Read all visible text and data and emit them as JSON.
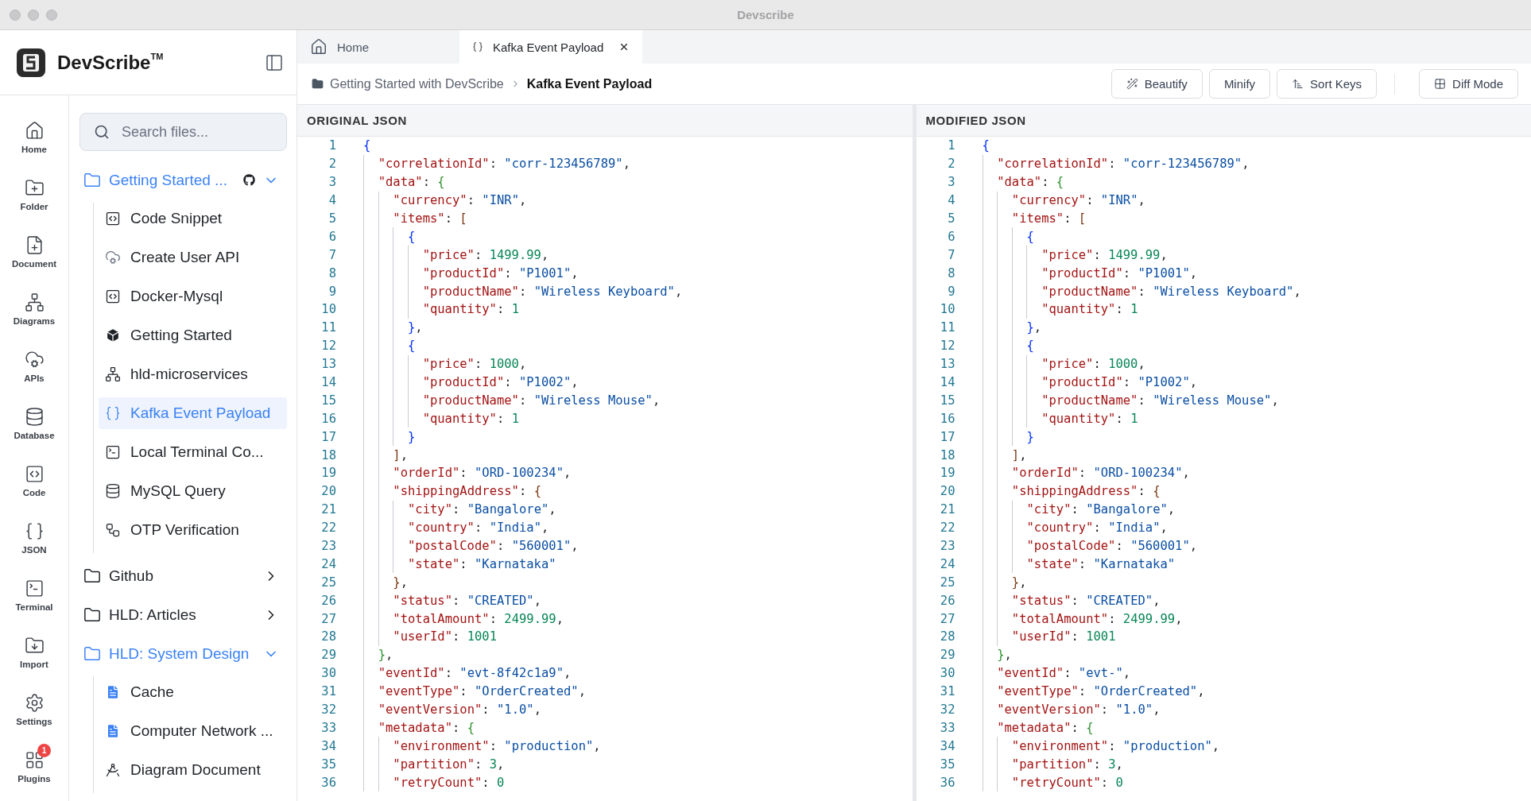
{
  "window": {
    "title": "Devscribe"
  },
  "sidebar": {
    "logo": "DevScribe$^{TM}$",
    "nav": [
      {
        "label": "Home",
        "kind": "home"
      },
      {
        "label": "Folder",
        "kind": "folder"
      },
      {
        "label": "Document",
        "kind": "document"
      },
      {
        "label": "Diagrams",
        "kind": "diagram"
      },
      {
        "label": "APIs",
        "kind": "api"
      },
      {
        "label": "Database",
        "kind": "database"
      },
      {
        "label": "Code",
        "kind": "code"
      },
      {
        "label": "JSON",
        "kind": "json"
      },
      {
        "label": "Terminal",
        "kind": "terminal"
      },
      {
        "label": "Import",
        "kind": "import"
      },
      {
        "label": "Settings",
        "kind": "settings"
      },
      {
        "label": "Plugins",
        "kind": "plugins",
        "badge": "1"
      }
    ],
    "search": {
      "placeholder": "Search files..."
    },
    "tree": [
      {
        "label": "Getting Started ...",
        "expanded": true,
        "repo_linked": true,
        "children": [
          {
            "label": "Code Snippet",
            "kind": "code",
            "selected": false
          },
          {
            "label": "Create User API",
            "kind": "api",
            "selected": false
          },
          {
            "label": "Docker-Mysql",
            "kind": "code",
            "selected": false
          },
          {
            "label": "Getting Started",
            "kind": "cube",
            "selected": false
          },
          {
            "label": "hld-microservices",
            "kind": "network",
            "selected": false
          },
          {
            "label": "Kafka Event Payload",
            "kind": "json",
            "selected": true
          },
          {
            "label": "Local Terminal Co...",
            "kind": "terminal",
            "selected": false
          },
          {
            "label": "MySQL Query",
            "kind": "database",
            "selected": false
          },
          {
            "label": "OTP Verification",
            "kind": "flow",
            "selected": false
          }
        ]
      },
      {
        "label": "Github",
        "expanded": false,
        "repo_linked": false
      },
      {
        "label": "HLD: Articles",
        "expanded": false,
        "repo_linked": false
      },
      {
        "label": "HLD: System Design",
        "expanded": true,
        "repo_linked": false,
        "children": [
          {
            "label": "Cache",
            "kind": "doc",
            "selected": false
          },
          {
            "label": "Computer Network ...",
            "kind": "doc",
            "selected": false
          },
          {
            "label": "Diagram Document",
            "kind": "diagram",
            "selected": false
          }
        ]
      }
    ]
  },
  "tabs": [
    {
      "label": "Home",
      "kind": "home",
      "selected": false,
      "closable": false
    },
    {
      "label": "Kafka Event Payload",
      "kind": "json",
      "selected": true,
      "closable": true
    }
  ],
  "breadcrumb": [
    "Getting Started with DevScribe",
    "Kafka Event Payload"
  ],
  "toolbar": [
    {
      "label": "Beautify",
      "kind": "beautify"
    },
    {
      "label": "Minify",
      "kind": "minify"
    },
    {
      "label": "Sort Keys",
      "kind": "sort"
    },
    {
      "label": "Diff Mode",
      "kind": "diff"
    }
  ],
  "panels": [
    {
      "title": "ORIGINAL JSON",
      "lines": [
        {
          "no": "1",
          "tokens": [
            {
              "kind": "open",
              "text": "{",
              "color": "#0431fa"
            }
          ]
        },
        {
          "no": "2",
          "tokens": [
            {
              "kind": "key",
              "text": "\"correlationId\""
            },
            {
              "kind": "punct",
              "text": ": "
            },
            {
              "kind": "string",
              "text": "\"corr-123456789\""
            },
            {
              "kind": "punct",
              "text": ","
            }
          ]
        },
        {
          "no": "3",
          "tokens": [
            {
              "kind": "key",
              "text": "\"data\""
            },
            {
              "kind": "punct",
              "text": ": "
            },
            {
              "kind": "open",
              "text": "{",
              "color": "#319331"
            }
          ]
        },
        {
          "no": "4",
          "tokens": [
            {
              "kind": "key",
              "text": "\"currency\""
            },
            {
              "kind": "punct",
              "text": ": "
            },
            {
              "kind": "string",
              "text": "\"INR\""
            },
            {
              "kind": "punct",
              "text": ","
            }
          ]
        },
        {
          "no": "5",
          "tokens": [
            {
              "kind": "key",
              "text": "\"items\""
            },
            {
              "kind": "punct",
              "text": ": "
            },
            {
              "kind": "open",
              "text": "[",
              "color": "#7b3814"
            }
          ]
        },
        {
          "no": "6",
          "tokens": [
            {
              "kind": "open",
              "text": "{",
              "color": "#0431fa"
            }
          ]
        },
        {
          "no": "7",
          "tokens": [
            {
              "kind": "key",
              "text": "\"price\""
            },
            {
              "kind": "punct",
              "text": ": "
            },
            {
              "kind": "number",
              "text": "1499.99"
            },
            {
              "kind": "punct",
              "text": ","
            }
          ]
        },
        {
          "no": "8",
          "tokens": [
            {
              "kind": "key",
              "text": "\"productId\""
            },
            {
              "kind": "punct",
              "text": ": "
            },
            {
              "kind": "string",
              "text": "\"P1001\""
            },
            {
              "kind": "punct",
              "text": ","
            }
          ]
        },
        {
          "no": "9",
          "tokens": [
            {
              "kind": "key",
              "text": "\"productName\""
            },
            {
              "kind": "punct",
              "text": ": "
            },
            {
              "kind": "string",
              "text": "\"Wireless Keyboard\""
            },
            {
              "kind": "punct",
              "text": ","
            }
          ]
        },
        {
          "no": "10",
          "tokens": [
            {
              "kind": "key",
              "text": "\"quantity\""
            },
            {
              "kind": "punct",
              "text": ": "
            },
            {
              "kind": "number",
              "text": "1"
            }
          ]
        },
        {
          "no": "11",
          "tokens": [
            {
              "kind": "close",
              "text": "}",
              "color": "#0431fa"
            },
            {
              "kind": "punct",
              "text": ","
            }
          ]
        },
        {
          "no": "12",
          "tokens": [
            {
              "kind": "open",
              "text": "{",
              "color": "#0431fa"
            }
          ]
        },
        {
          "no": "13",
          "tokens": [
            {
              "kind": "key",
              "text": "\"price\""
            },
            {
              "kind": "punct",
              "text": ": "
            },
            {
              "kind": "number",
              "text": "1000"
            },
            {
              "kind": "punct",
              "text": ","
            }
          ]
        },
        {
          "no": "14",
          "tokens": [
            {
              "kind": "key",
              "text": "\"productId\""
            },
            {
              "kind": "punct",
              "text": ": "
            },
            {
              "kind": "string",
              "text": "\"P1002\""
            },
            {
              "kind": "punct",
              "text": ","
            }
          ]
        },
        {
          "no": "15",
          "tokens": [
            {
              "kind": "key",
              "text": "\"productName\""
            },
            {
              "kind": "punct",
              "text": ": "
            },
            {
              "kind": "string",
              "text": "\"Wireless Mouse\""
            },
            {
              "kind": "punct",
              "text": ","
            }
          ]
        },
        {
          "no": "16",
          "tokens": [
            {
              "kind": "key",
              "text": "\"quantity\""
            },
            {
              "kind": "punct",
              "text": ": "
            },
            {
              "kind": "number",
              "text": "1"
            }
          ]
        },
        {
          "no": "17",
          "tokens": [
            {
              "kind": "close",
              "text": "}",
              "color": "#0431fa"
            }
          ]
        },
        {
          "no": "18",
          "tokens": [
            {
              "kind": "close",
              "text": "]",
              "color": "#7b3814"
            },
            {
              "kind": "punct",
              "text": ","
            }
          ]
        },
        {
          "no": "19",
          "tokens": [
            {
              "kind": "key",
              "text": "\"orderId\""
            },
            {
              "kind": "punct",
              "text": ": "
            },
            {
              "kind": "string",
              "text": "\"ORD-100234\""
            },
            {
              "kind": "punct",
              "text": ","
            }
          ]
        },
        {
          "no": "20",
          "tokens": [
            {
              "kind": "key",
              "text": "\"shippingAddress\""
            },
            {
              "kind": "punct",
              "text": ": "
            },
            {
              "kind": "open",
              "text": "{",
              "color": "#7b3814"
            }
          ]
        },
        {
          "no": "21",
          "tokens": [
            {
              "kind": "key",
              "text": "\"city\""
            },
            {
              "kind": "punct",
              "text": ": "
            },
            {
              "kind": "string",
              "text": "\"Bangalore\""
            },
            {
              "kind": "punct",
              "text": ","
            }
          ]
        },
        {
          "no": "22",
          "tokens": [
            {
              "kind": "key",
              "text": "\"country\""
            },
            {
              "kind": "punct",
              "text": ": "
            },
            {
              "kind": "string",
              "text": "\"India\""
            },
            {
              "kind": "punct",
              "text": ","
            }
          ]
        },
        {
          "no": "23",
          "tokens": [
            {
              "kind": "key",
              "text": "\"postalCode\""
            },
            {
              "kind": "punct",
              "text": ": "
            },
            {
              "kind": "string",
              "text": "\"560001\""
            },
            {
              "kind": "punct",
              "text": ","
            }
          ]
        },
        {
          "no": "24",
          "tokens": [
            {
              "kind": "key",
              "text": "\"state\""
            },
            {
              "kind": "punct",
              "text": ": "
            },
            {
              "kind": "string",
              "text": "\"Karnataka\""
            }
          ]
        },
        {
          "no": "25",
          "tokens": [
            {
              "kind": "close",
              "text": "}",
              "color": "#7b3814"
            },
            {
              "kind": "punct",
              "text": ","
            }
          ]
        },
        {
          "no": "26",
          "tokens": [
            {
              "kind": "key",
              "text": "\"status\""
            },
            {
              "kind": "punct",
              "text": ": "
            },
            {
              "kind": "string",
              "text": "\"CREATED\""
            },
            {
              "kind": "punct",
              "text": ","
            }
          ]
        },
        {
          "no": "27",
          "tokens": [
            {
              "kind": "key",
              "text": "\"totalAmount\""
            },
            {
              "kind": "punct",
              "text": ": "
            },
            {
              "kind": "number",
              "text": "2499.99"
            },
            {
              "kind": "punct",
              "text": ","
            }
          ]
        },
        {
          "no": "28",
          "tokens": [
            {
              "kind": "key",
              "text": "\"userId\""
            },
            {
              "kind": "punct",
              "text": ": "
            },
            {
              "kind": "number",
              "text": "1001"
            }
          ]
        },
        {
          "no": "29",
          "tokens": [
            {
              "kind": "close",
              "text": "}",
              "color": "#319331"
            },
            {
              "kind": "punct",
              "text": ","
            }
          ]
        },
        {
          "no": "30",
          "tokens": [
            {
              "kind": "key",
              "text": "\"eventId\""
            },
            {
              "kind": "punct",
              "text": ": "
            },
            {
              "kind": "string",
              "text": "\"evt-8f42c1a9\""
            },
            {
              "kind": "punct",
              "text": ","
            }
          ]
        },
        {
          "no": "31",
          "tokens": [
            {
              "kind": "key",
              "text": "\"eventType\""
            },
            {
              "kind": "punct",
              "text": ": "
            },
            {
              "kind": "string",
              "text": "\"OrderCreated\""
            },
            {
              "kind": "punct",
              "text": ","
            }
          ]
        },
        {
          "no": "32",
          "tokens": [
            {
              "kind": "key",
              "text": "\"eventVersion\""
            },
            {
              "kind": "punct",
              "text": ": "
            },
            {
              "kind": "string",
              "text": "\"1.0\""
            },
            {
              "kind": "punct",
              "text": ","
            }
          ]
        },
        {
          "no": "33",
          "tokens": [
            {
              "kind": "key",
              "text": "\"metadata\""
            },
            {
              "kind": "punct",
              "text": ": "
            },
            {
              "kind": "open",
              "text": "{",
              "color": "#319331"
            }
          ]
        },
        {
          "no": "34",
          "tokens": [
            {
              "kind": "key",
              "text": "\"environment\""
            },
            {
              "kind": "punct",
              "text": ": "
            },
            {
              "kind": "string",
              "text": "\"production\""
            },
            {
              "kind": "punct",
              "text": ","
            }
          ]
        },
        {
          "no": "35",
          "tokens": [
            {
              "kind": "key",
              "text": "\"partition\""
            },
            {
              "kind": "punct",
              "text": ": "
            },
            {
              "kind": "number",
              "text": "3"
            },
            {
              "kind": "punct",
              "text": ","
            }
          ]
        },
        {
          "no": "36",
          "tokens": [
            {
              "kind": "key",
              "text": "\"retryCount\""
            },
            {
              "kind": "punct",
              "text": ": "
            },
            {
              "kind": "number",
              "text": "0"
            }
          ]
        }
      ]
    },
    {
      "title": "MODIFIED JSON",
      "lines": [
        {
          "no": "1",
          "tokens": [
            {
              "kind": "open",
              "text": "{",
              "color": "#0431fa"
            }
          ]
        },
        {
          "no": "2",
          "tokens": [
            {
              "kind": "key",
              "text": "\"correlationId\""
            },
            {
              "kind": "punct",
              "text": ": "
            },
            {
              "kind": "string",
              "text": "\"corr-123456789\""
            },
            {
              "kind": "punct",
              "text": ","
            }
          ]
        },
        {
          "no": "3",
          "tokens": [
            {
              "kind": "key",
              "text": "\"data\""
            },
            {
              "kind": "punct",
              "text": ": "
            },
            {
              "kind": "open",
              "text": "{",
              "color": "#319331"
            }
          ]
        },
        {
          "no": "4",
          "tokens": [
            {
              "kind": "key",
              "text": "\"currency\""
            },
            {
              "kind": "punct",
              "text": ": "
            },
            {
              "kind": "string",
              "text": "\"INR\""
            },
            {
              "kind": "punct",
              "text": ","
            }
          ]
        },
        {
          "no": "5",
          "tokens": [
            {
              "kind": "key",
              "text": "\"items\""
            },
            {
              "kind": "punct",
              "text": ": "
            },
            {
              "kind": "open",
              "text": "[",
              "color": "#7b3814"
            }
          ]
        },
        {
          "no": "6",
          "tokens": [
            {
              "kind": "open",
              "text": "{",
              "color": "#0431fa"
            }
          ]
        },
        {
          "no": "7",
          "tokens": [
            {
              "kind": "key",
              "text": "\"price\""
            },
            {
              "kind": "punct",
              "text": ": "
            },
            {
              "kind": "number",
              "text": "1499.99"
            },
            {
              "kind": "punct",
              "text": ","
            }
          ]
        },
        {
          "no": "8",
          "tokens": [
            {
              "kind": "key",
              "text": "\"productId\""
            },
            {
              "kind": "punct",
              "text": ": "
            },
            {
              "kind": "string",
              "text": "\"P1001\""
            },
            {
              "kind": "punct",
              "text": ","
            }
          ]
        },
        {
          "no": "9",
          "tokens": [
            {
              "kind": "key",
              "text": "\"productName\""
            },
            {
              "kind": "punct",
              "text": ": "
            },
            {
              "kind": "string",
              "text": "\"Wireless Keyboard\""
            },
            {
              "kind": "punct",
              "text": ","
            }
          ]
        },
        {
          "no": "10",
          "tokens": [
            {
              "kind": "key",
              "text": "\"quantity\""
            },
            {
              "kind": "punct",
              "text": ": "
            },
            {
              "kind": "number",
              "text": "1"
            }
          ]
        },
        {
          "no": "11",
          "tokens": [
            {
              "kind": "close",
              "text": "}",
              "color": "#0431fa"
            },
            {
              "kind": "punct",
              "text": ","
            }
          ]
        },
        {
          "no": "12",
          "tokens": [
            {
              "kind": "open",
              "text": "{",
              "color": "#0431fa"
            }
          ]
        },
        {
          "no": "13",
          "tokens": [
            {
              "kind": "key",
              "text": "\"price\""
            },
            {
              "kind": "punct",
              "text": ": "
            },
            {
              "kind": "number",
              "text": "1000"
            },
            {
              "kind": "punct",
              "text": ","
            }
          ]
        },
        {
          "no": "14",
          "tokens": [
            {
              "kind": "key",
              "text": "\"productId\""
            },
            {
              "kind": "punct",
              "text": ": "
            },
            {
              "kind": "string",
              "text": "\"P1002\""
            },
            {
              "kind": "punct",
              "text": ","
            }
          ]
        },
        {
          "no": "15",
          "tokens": [
            {
              "kind": "key",
              "text": "\"productName\""
            },
            {
              "kind": "punct",
              "text": ": "
            },
            {
              "kind": "string",
              "text": "\"Wireless Mouse\""
            },
            {
              "kind": "punct",
              "text": ","
            }
          ]
        },
        {
          "no": "16",
          "tokens": [
            {
              "kind": "key",
              "text": "\"quantity\""
            },
            {
              "kind": "punct",
              "text": ": "
            },
            {
              "kind": "number",
              "text": "1"
            }
          ]
        },
        {
          "no": "17",
          "tokens": [
            {
              "kind": "close",
              "text": "}",
              "color": "#0431fa"
            }
          ]
        },
        {
          "no": "18",
          "tokens": [
            {
              "kind": "close",
              "text": "]",
              "color": "#7b3814"
            },
            {
              "kind": "punct",
              "text": ","
            }
          ]
        },
        {
          "no": "19",
          "tokens": [
            {
              "kind": "key",
              "text": "\"orderId\""
            },
            {
              "kind": "punct",
              "text": ": "
            },
            {
              "kind": "string",
              "text": "\"ORD-100234\""
            },
            {
              "kind": "punct",
              "text": ","
            }
          ]
        },
        {
          "no": "20",
          "tokens": [
            {
              "kind": "key",
              "text": "\"shippingAddress\""
            },
            {
              "kind": "punct",
              "text": ": "
            },
            {
              "kind": "open",
              "text": "{",
              "color": "#7b3814"
            }
          ]
        },
        {
          "no": "21",
          "tokens": [
            {
              "kind": "key",
              "text": "\"city\""
            },
            {
              "kind": "punct",
              "text": ": "
            },
            {
              "kind": "string",
              "text": "\"Bangalore\""
            },
            {
              "kind": "punct",
              "text": ","
            }
          ]
        },
        {
          "no": "22",
          "tokens": [
            {
              "kind": "key",
              "text": "\"country\""
            },
            {
              "kind": "punct",
              "text": ": "
            },
            {
              "kind": "string",
              "text": "\"India\""
            },
            {
              "kind": "punct",
              "text": ","
            }
          ]
        },
        {
          "no": "23",
          "tokens": [
            {
              "kind": "key",
              "text": "\"postalCode\""
            },
            {
              "kind": "punct",
              "text": ": "
            },
            {
              "kind": "string",
              "text": "\"560001\""
            },
            {
              "kind": "punct",
              "text": ","
            }
          ]
        },
        {
          "no": "24",
          "tokens": [
            {
              "kind": "key",
              "text": "\"state\""
            },
            {
              "kind": "punct",
              "text": ": "
            },
            {
              "kind": "string",
              "text": "\"Karnataka\""
            }
          ]
        },
        {
          "no": "25",
          "tokens": [
            {
              "kind": "close",
              "text": "}",
              "color": "#7b3814"
            },
            {
              "kind": "punct",
              "text": ","
            }
          ]
        },
        {
          "no": "26",
          "tokens": [
            {
              "kind": "key",
              "text": "\"status\""
            },
            {
              "kind": "punct",
              "text": ": "
            },
            {
              "kind": "string",
              "text": "\"CREATED\""
            },
            {
              "kind": "punct",
              "text": ","
            }
          ]
        },
        {
          "no": "27",
          "tokens": [
            {
              "kind": "key",
              "text": "\"totalAmount\""
            },
            {
              "kind": "punct",
              "text": ": "
            },
            {
              "kind": "number",
              "text": "2499.99"
            },
            {
              "kind": "punct",
              "text": ","
            }
          ]
        },
        {
          "no": "28",
          "tokens": [
            {
              "kind": "key",
              "text": "\"userId\""
            },
            {
              "kind": "punct",
              "text": ": "
            },
            {
              "kind": "number",
              "text": "1001"
            }
          ]
        },
        {
          "no": "29",
          "tokens": [
            {
              "kind": "close",
              "text": "}",
              "color": "#319331"
            },
            {
              "kind": "punct",
              "text": ","
            }
          ]
        },
        {
          "no": "30",
          "tokens": [
            {
              "kind": "key",
              "text": "\"eventId\""
            },
            {
              "kind": "punct",
              "text": ": "
            },
            {
              "kind": "string",
              "text": "\"evt-\""
            },
            {
              "kind": "punct",
              "text": ","
            }
          ]
        },
        {
          "no": "31",
          "tokens": [
            {
              "kind": "key",
              "text": "\"eventType\""
            },
            {
              "kind": "punct",
              "text": ": "
            },
            {
              "kind": "string",
              "text": "\"OrderCreated\""
            },
            {
              "kind": "punct",
              "text": ","
            }
          ]
        },
        {
          "no": "32",
          "tokens": [
            {
              "kind": "key",
              "text": "\"eventVersion\""
            },
            {
              "kind": "punct",
              "text": ": "
            },
            {
              "kind": "string",
              "text": "\"1.0\""
            },
            {
              "kind": "punct",
              "text": ","
            }
          ]
        },
        {
          "no": "33",
          "tokens": [
            {
              "kind": "key",
              "text": "\"metadata\""
            },
            {
              "kind": "punct",
              "text": ": "
            },
            {
              "kind": "open",
              "text": "{",
              "color": "#319331"
            }
          ]
        },
        {
          "no": "34",
          "tokens": [
            {
              "kind": "key",
              "text": "\"environment\""
            },
            {
              "kind": "punct",
              "text": ": "
            },
            {
              "kind": "string",
              "text": "\"production\""
            },
            {
              "kind": "punct",
              "text": ","
            }
          ]
        },
        {
          "no": "35",
          "tokens": [
            {
              "kind": "key",
              "text": "\"partition\""
            },
            {
              "kind": "punct",
              "text": ": "
            },
            {
              "kind": "number",
              "text": "3"
            },
            {
              "kind": "punct",
              "text": ","
            }
          ]
        },
        {
          "no": "36",
          "tokens": [
            {
              "kind": "key",
              "text": "\"retryCount\""
            },
            {
              "kind": "punct",
              "text": ": "
            },
            {
              "kind": "number",
              "text": "0"
            }
          ]
        }
      ]
    }
  ]
}
